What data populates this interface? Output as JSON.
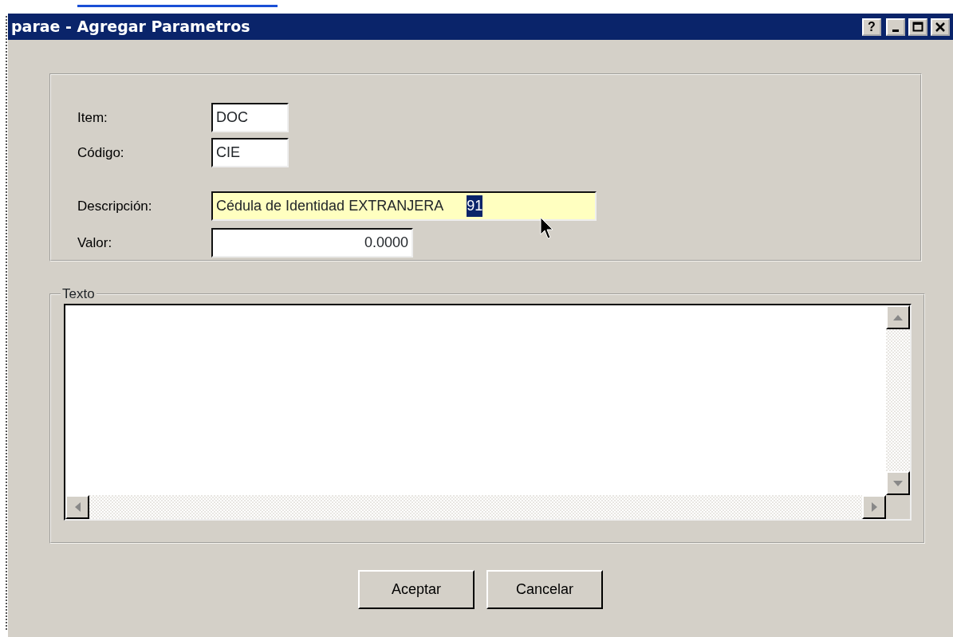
{
  "window": {
    "title": "parae - Agregar Parametros"
  },
  "title_buttons": [
    {
      "kind": "help",
      "label": "?"
    },
    {
      "kind": "minimize"
    },
    {
      "kind": "maximize"
    },
    {
      "kind": "close"
    }
  ],
  "fields": [
    {
      "label": "Item:",
      "value": "DOC",
      "kind": "short",
      "focused": false
    },
    {
      "label": "Código:",
      "value": "CIE",
      "kind": "short",
      "focused": false
    },
    {
      "label": "Descripción:",
      "value": "Cédula de Identidad EXTRANJERA",
      "selected_text": "91",
      "kind": "wide",
      "focused": true
    },
    {
      "label": "Valor:",
      "value": "0.0000",
      "kind": "number",
      "focused": false
    }
  ],
  "text_group": {
    "legend": "Texto"
  },
  "buttons": [
    {
      "label": "Aceptar"
    },
    {
      "label": "Cancelar"
    }
  ]
}
